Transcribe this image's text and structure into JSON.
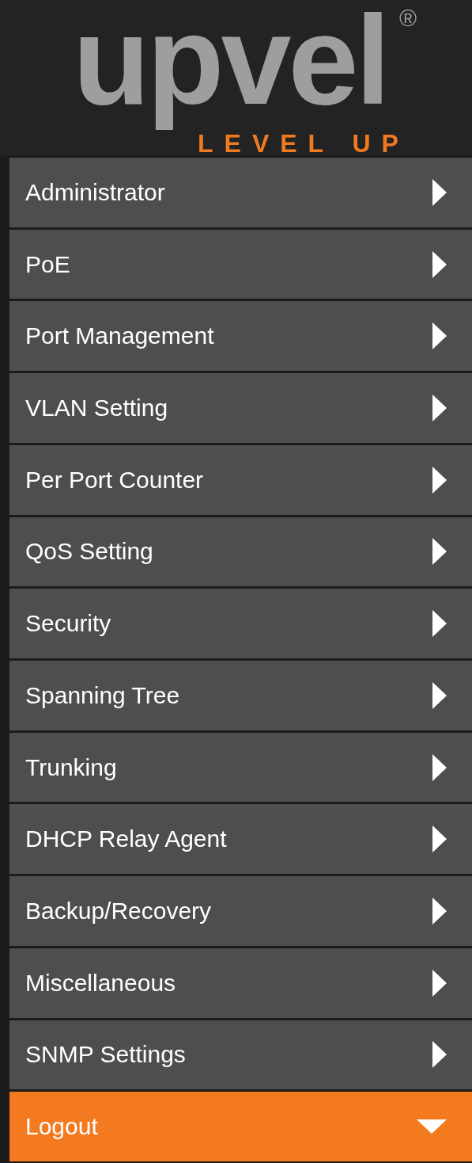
{
  "logo": {
    "wordmark": "upvel",
    "registered": "®",
    "tagline": "LEVEL UP"
  },
  "menu": [
    {
      "label": "Administrator",
      "expanded": false
    },
    {
      "label": "PoE",
      "expanded": false
    },
    {
      "label": "Port Management",
      "expanded": false
    },
    {
      "label": "VLAN Setting",
      "expanded": false
    },
    {
      "label": "Per Port Counter",
      "expanded": false
    },
    {
      "label": "QoS Setting",
      "expanded": false
    },
    {
      "label": "Security",
      "expanded": false
    },
    {
      "label": "Spanning Tree",
      "expanded": false
    },
    {
      "label": "Trunking",
      "expanded": false
    },
    {
      "label": "DHCP Relay Agent",
      "expanded": false
    },
    {
      "label": "Backup/Recovery",
      "expanded": false
    },
    {
      "label": "Miscellaneous",
      "expanded": false
    },
    {
      "label": "SNMP Settings",
      "expanded": false
    },
    {
      "label": "Logout",
      "expanded": true
    }
  ]
}
